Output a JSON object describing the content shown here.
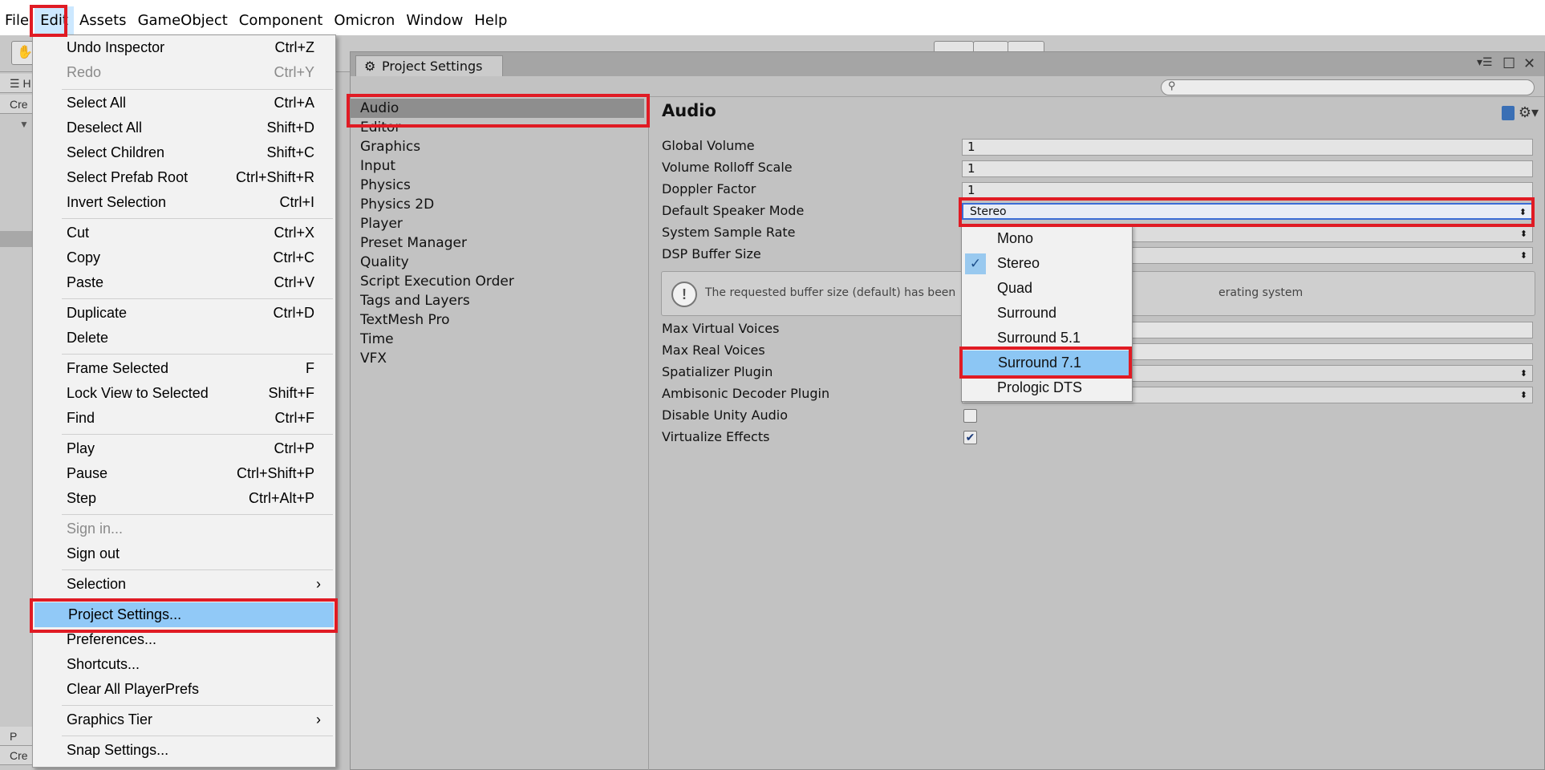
{
  "menubar": {
    "items": [
      "File",
      "Edit",
      "Assets",
      "GameObject",
      "Component",
      "Omicron",
      "Window",
      "Help"
    ]
  },
  "left_panel": {
    "rows": [
      "H",
      "Cre"
    ],
    "bottom_rows": [
      "P",
      "Cre"
    ]
  },
  "edit_menu": {
    "items": [
      {
        "label": "Undo Inspector",
        "shortcut": "Ctrl+Z"
      },
      {
        "label": "Redo",
        "shortcut": "Ctrl+Y"
      },
      {
        "label": "Select All",
        "shortcut": "Ctrl+A"
      },
      {
        "label": "Deselect All",
        "shortcut": "Shift+D"
      },
      {
        "label": "Select Children",
        "shortcut": "Shift+C"
      },
      {
        "label": "Select Prefab Root",
        "shortcut": "Ctrl+Shift+R"
      },
      {
        "label": "Invert Selection",
        "shortcut": "Ctrl+I"
      },
      {
        "label": "Cut",
        "shortcut": "Ctrl+X"
      },
      {
        "label": "Copy",
        "shortcut": "Ctrl+C"
      },
      {
        "label": "Paste",
        "shortcut": "Ctrl+V"
      },
      {
        "label": "Duplicate",
        "shortcut": "Ctrl+D"
      },
      {
        "label": "Delete",
        "shortcut": ""
      },
      {
        "label": "Frame Selected",
        "shortcut": "F"
      },
      {
        "label": "Lock View to Selected",
        "shortcut": "Shift+F"
      },
      {
        "label": "Find",
        "shortcut": "Ctrl+F"
      },
      {
        "label": "Play",
        "shortcut": "Ctrl+P"
      },
      {
        "label": "Pause",
        "shortcut": "Ctrl+Shift+P"
      },
      {
        "label": "Step",
        "shortcut": "Ctrl+Alt+P"
      },
      {
        "label": "Sign in...",
        "shortcut": ""
      },
      {
        "label": "Sign out",
        "shortcut": ""
      },
      {
        "label": "Selection",
        "shortcut": ""
      },
      {
        "label": "Project Settings...",
        "shortcut": ""
      },
      {
        "label": "Preferences...",
        "shortcut": ""
      },
      {
        "label": "Shortcuts...",
        "shortcut": ""
      },
      {
        "label": "Clear All PlayerPrefs",
        "shortcut": ""
      },
      {
        "label": "Graphics Tier",
        "shortcut": ""
      },
      {
        "label": "Snap Settings...",
        "shortcut": ""
      }
    ],
    "submenu_arrow": "›"
  },
  "project_settings": {
    "tab_title": "Project Settings",
    "nav": [
      "Audio",
      "Editor",
      "Graphics",
      "Input",
      "Physics",
      "Physics 2D",
      "Player",
      "Preset Manager",
      "Quality",
      "Script Execution Order",
      "Tags and Layers",
      "TextMesh Pro",
      "Time",
      "VFX"
    ],
    "selected_nav": "Audio",
    "heading": "Audio",
    "properties": {
      "global_volume": {
        "label": "Global Volume",
        "value": "1"
      },
      "volume_rolloff_scale": {
        "label": "Volume Rolloff Scale",
        "value": "1"
      },
      "doppler_factor": {
        "label": "Doppler Factor",
        "value": "1"
      },
      "default_speaker_mode": {
        "label": "Default Speaker Mode",
        "value": "Stereo"
      },
      "system_sample_rate": {
        "label": "System Sample Rate",
        "value": ""
      },
      "dsp_buffer_size": {
        "label": "DSP Buffer Size",
        "value": ""
      },
      "max_virtual_voices": {
        "label": "Max Virtual Voices",
        "value": ""
      },
      "max_real_voices": {
        "label": "Max Real Voices",
        "value": ""
      },
      "spatializer_plugin": {
        "label": "Spatializer Plugin",
        "value": ""
      },
      "ambisonic_decoder_plugin": {
        "label": "Ambisonic Decoder Plugin",
        "value": ""
      },
      "disable_unity_audio": {
        "label": "Disable Unity Audio",
        "checked": false
      },
      "virtualize_effects": {
        "label": "Virtualize Effects",
        "checked": true
      }
    },
    "help_message_left": "The requested buffer size (default) has been",
    "help_message_right": "erating system"
  },
  "speaker_popup": {
    "options": [
      "Mono",
      "Stereo",
      "Quad",
      "Surround",
      "Surround 5.1",
      "Surround 7.1",
      "Prologic DTS"
    ],
    "checked": "Stereo",
    "highlighted": "Surround 7.1",
    "check_glyph": "✓"
  },
  "colors": {
    "highlight_red": "#e01b24",
    "menu_hover": "#91c9f7",
    "popup_hover": "#8cc6f4"
  }
}
